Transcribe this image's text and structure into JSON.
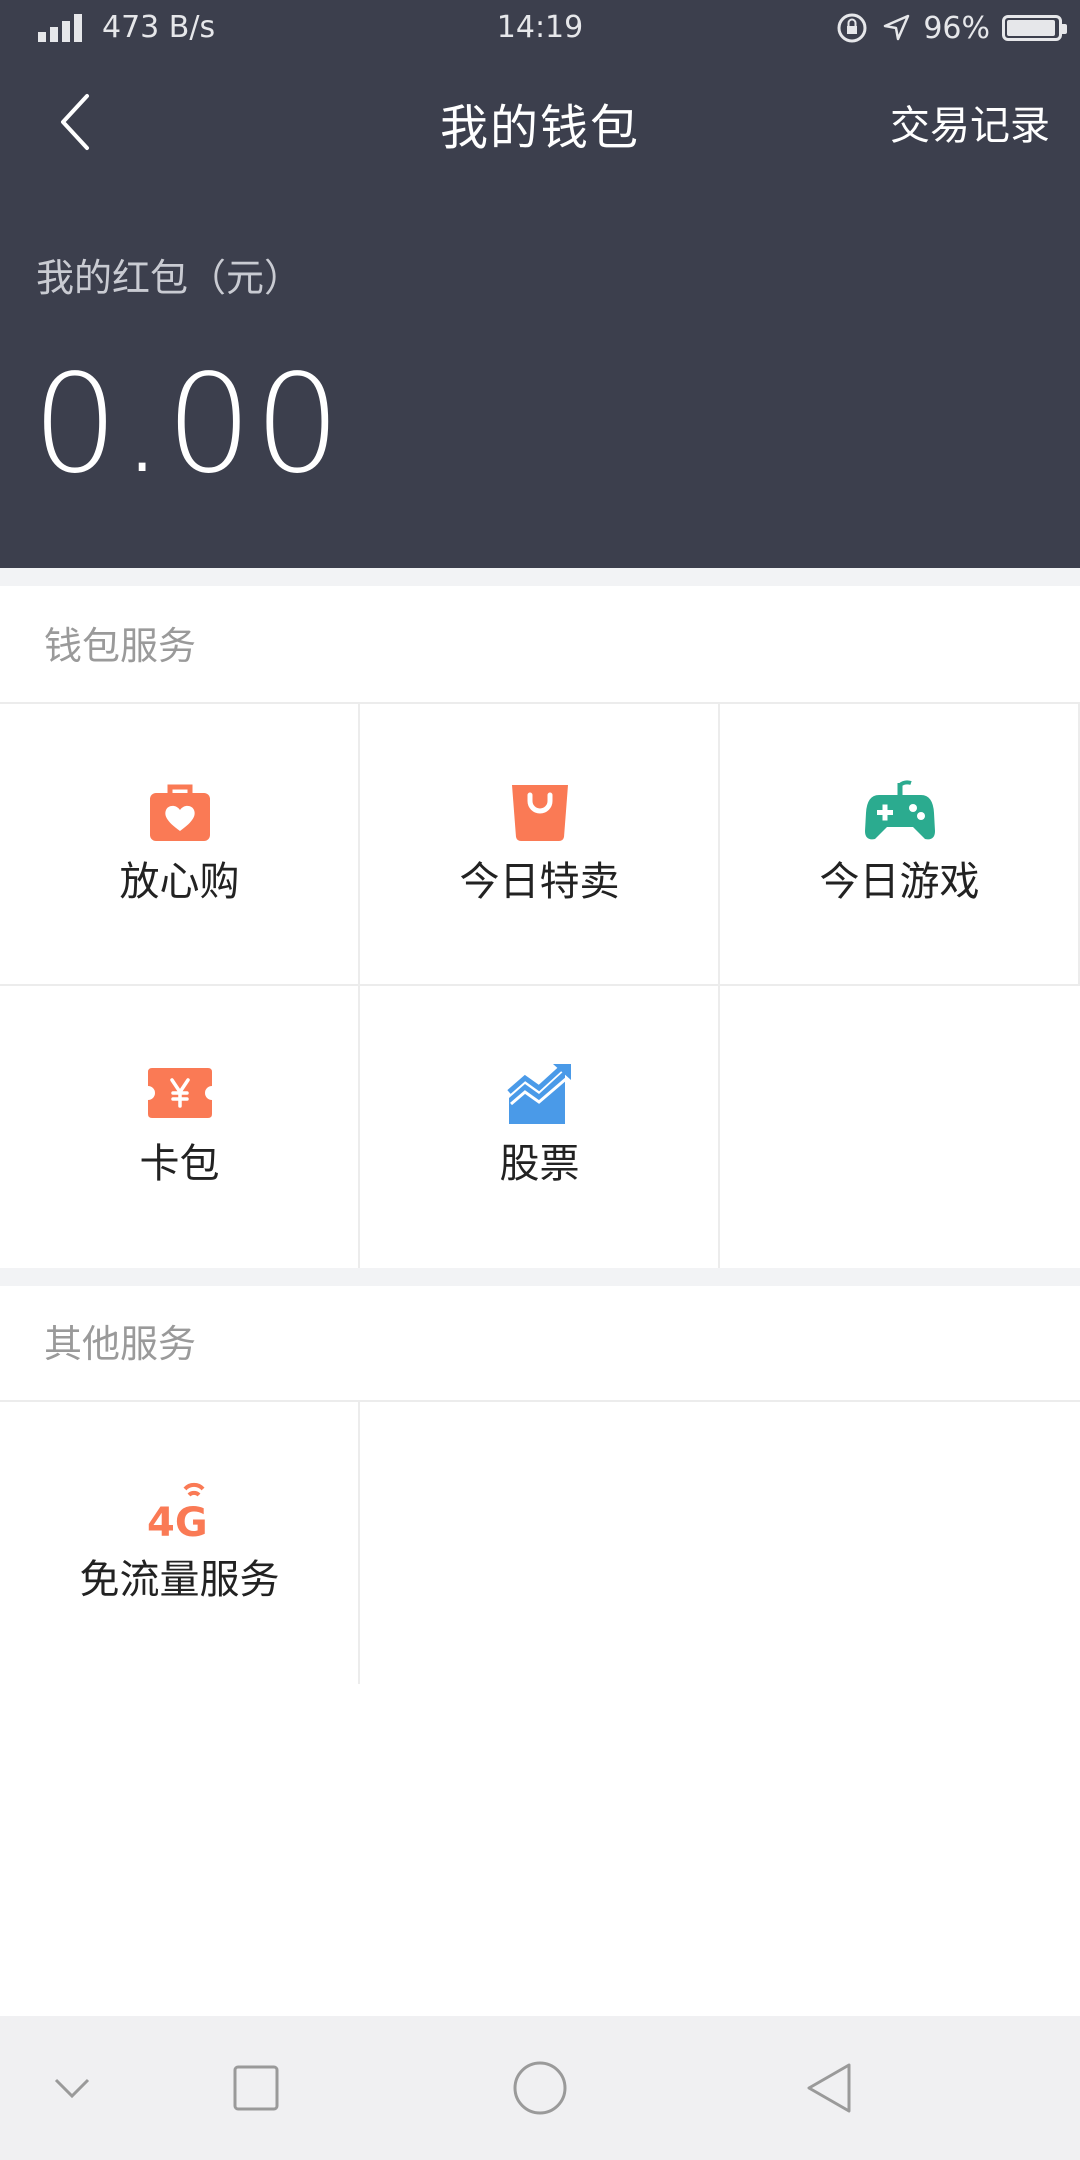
{
  "status_bar": {
    "network_speed": "473 B/s",
    "time": "14:19",
    "battery": "96%",
    "battery_level": 0.96
  },
  "nav": {
    "title": "我的钱包",
    "action": "交易记录"
  },
  "balance": {
    "label": "我的红包（元）",
    "value": "0.00"
  },
  "wallet_services": {
    "title": "钱包服务",
    "items": [
      {
        "label": "放心购",
        "icon": "heart-bag-icon",
        "color": "#fa7a55"
      },
      {
        "label": "今日特卖",
        "icon": "shopping-bag-icon",
        "color": "#fa7a55"
      },
      {
        "label": "今日游戏",
        "icon": "gamepad-icon",
        "color": "#2bab8f"
      },
      {
        "label": "卡包",
        "icon": "yuan-ticket-icon",
        "color": "#fa7a55"
      },
      {
        "label": "股票",
        "icon": "stock-chart-icon",
        "color": "#4a9ae8"
      }
    ]
  },
  "other_services": {
    "title": "其他服务",
    "items": [
      {
        "label": "免流量服务",
        "icon": "4g-icon",
        "color": "#fa7a55"
      }
    ]
  },
  "colors": {
    "header_bg": "#3c3f4d",
    "orange": "#fa7a55",
    "green": "#2bab8f",
    "blue": "#4a9ae8"
  }
}
